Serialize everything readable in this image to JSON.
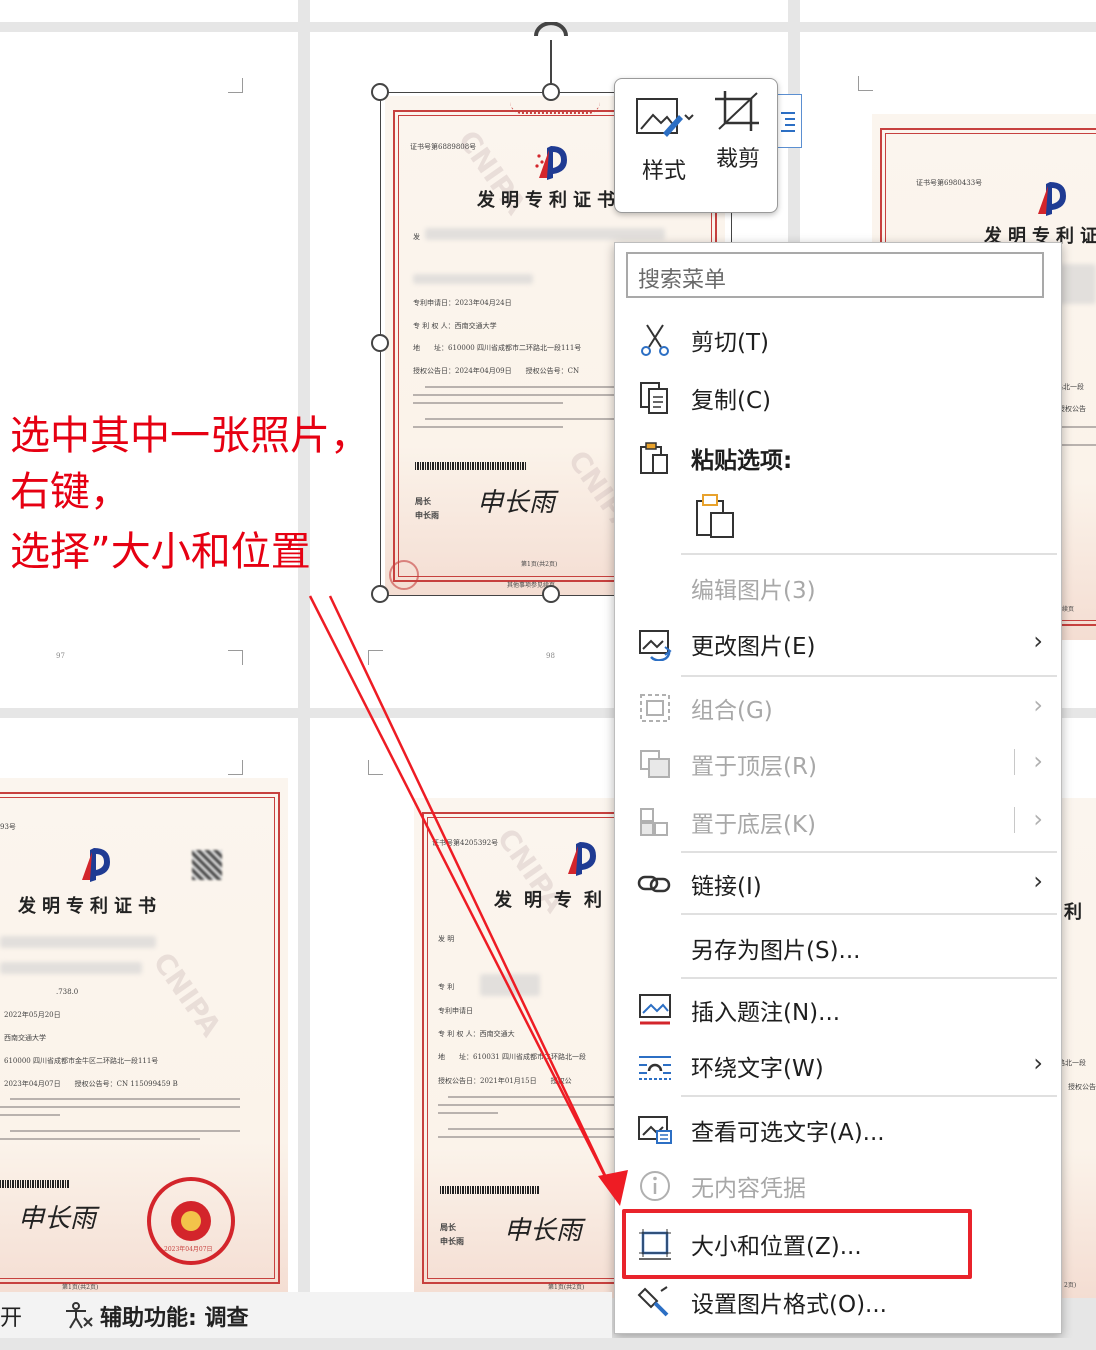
{
  "annotation": {
    "line1": "选中其中一张照片，",
    "line2": "右键，",
    "line3": "选择”大小和位置"
  },
  "certificates": {
    "serial_main": "证书号第6889808号",
    "serial_right": "证书号第6980433号",
    "serial_bottom_mid": "证书号第4205392号",
    "serial_bottom_left": "93号",
    "title": "发明专利证书",
    "title_short": "发明专利",
    "title_right": "发明专利证",
    "title_bottom_right": "利",
    "main_lines": [
      "发",
      "专利申请日：2023年04月24日",
      "专 利 权 人：西南交通大学",
      "地　　址：610000 四川省成都市二环路北一段111号",
      "授权公告日：2024年04月09日　　授权公告号：CN"
    ],
    "main_footer": "第1页(共2页)",
    "main_footer2": "其他事项参见续页",
    "director_label": "局长",
    "director_name": "申长雨",
    "signature": "申长雨",
    "page_left_num": "97",
    "page_mid_num": "98",
    "bottom_left_lines": [
      ".738.0",
      "2022年05月20日",
      "西南交通大学",
      "610000 四川省成都市金牛区二环路北一段111号",
      "2023年04月07日　　授权公告号：CN 115099459 B"
    ],
    "bottom_left_footer": "第1页(共2页)",
    "seal_date": "2023年04月07日",
    "bottom_mid_lines": [
      "发 明",
      "专 利",
      "专利申请日",
      "专 利 权 人：西南交通大",
      "地　　址：610031 四川省成都市二环路北一段",
      "授权公告日：2021年01月15日　　授权公"
    ],
    "bottom_mid_footer": "第1页(共2页)",
    "right_lines": [
      "路北一段",
      "授权公告",
      "路北一段",
      "授权公告"
    ],
    "right_footer": "续页",
    "right_footer2": "2页)",
    "watermark": "CNIPA"
  },
  "mini_toolbar": {
    "style_label": "样式",
    "crop_label": "裁剪"
  },
  "context_menu": {
    "search_placeholder": "搜索菜单",
    "cut": "剪切(T)",
    "copy": "复制(C)",
    "paste_options": "粘贴选项:",
    "edit_picture": "编辑图片(3)",
    "change_picture": "更改图片(E)",
    "group": "组合(G)",
    "bring_front": "置于顶层(R)",
    "send_back": "置于底层(K)",
    "link": "链接(I)",
    "save_as_picture": "另存为图片(S)...",
    "insert_caption": "插入题注(N)...",
    "wrap_text": "环绕文字(W)",
    "alt_text": "查看可选文字(A)...",
    "no_content_cred": "无内容凭据",
    "size_position": "大小和位置(Z)...",
    "format_picture": "设置图片格式(O)...",
    "submenu_arrow": "›"
  },
  "status_bar": {
    "left_text": "开",
    "accessibility": "辅助功能: 调查"
  },
  "colors": {
    "annotation_red": "#e60012",
    "highlight_box": "#e9232b",
    "certificate_border": "#c7413f",
    "logo_blue": "#1f3b93",
    "logo_red": "#d3252b"
  }
}
